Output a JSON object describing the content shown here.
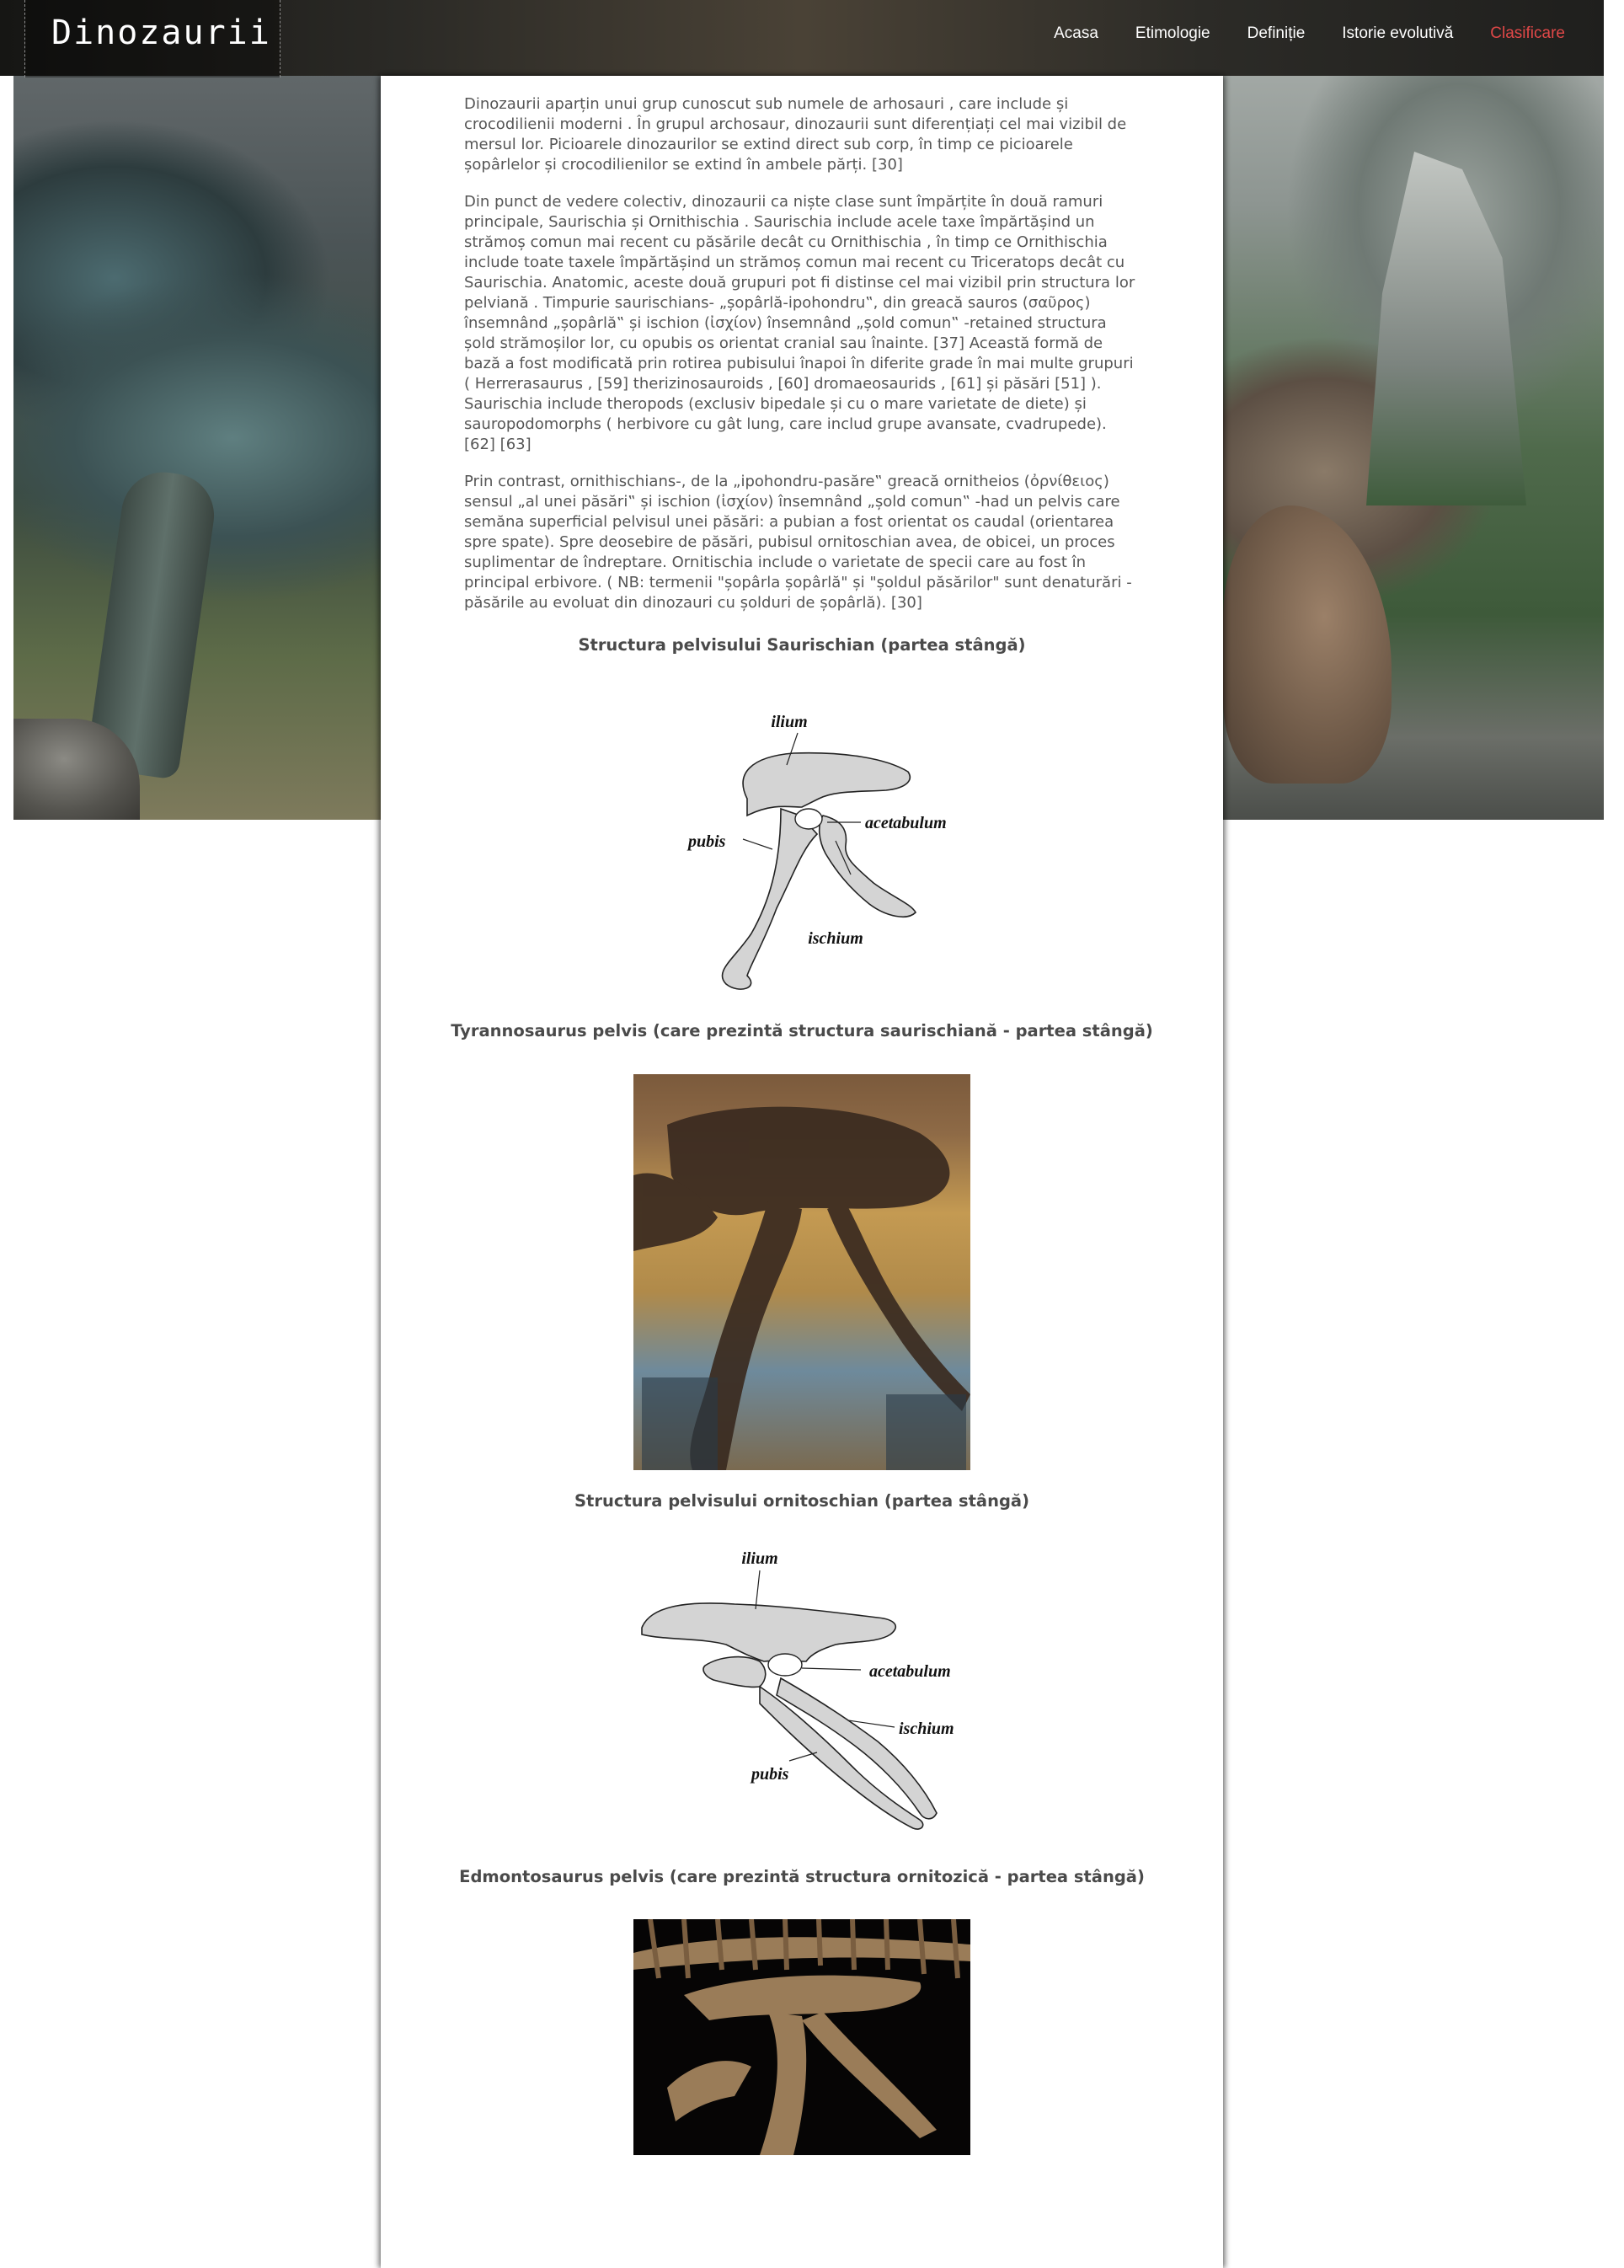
{
  "header": {
    "brand": "Dinozaurii",
    "nav": [
      {
        "label": "Acasa",
        "active": false
      },
      {
        "label": "Etimologie",
        "active": false
      },
      {
        "label": "Definiție",
        "active": false
      },
      {
        "label": "Istorie evolutivă",
        "active": false
      },
      {
        "label": "Clasificare",
        "active": true
      }
    ],
    "active_color": "#e04848"
  },
  "paragraphs": [
    "Dinozaurii aparțin unui grup cunoscut sub numele de arhosauri , care include și crocodilienii moderni . În grupul archosaur, dinozaurii sunt diferențiați cel mai vizibil de mersul lor. Picioarele dinozaurilor se extind direct sub corp, în timp ce picioarele șopârlelor și crocodilienilor se extind în ambele părți. [30]",
    "Din punct de vedere colectiv, dinozaurii ca niște clase sunt împărțite în două ramuri principale, Saurischia și Ornithischia . Saurischia include acele taxe împărtășind un strămoș comun mai recent cu păsările decât cu Ornithischia , în timp ce Ornithischia include toate taxele împărtășind un strămoș comun mai recent cu Triceratops decât cu Saurischia. Anatomic, aceste două grupuri pot fi distinse cel mai vizibil prin structura lor pelviană . Timpurie saurischians- „șopârlă-ipohondru‟, din greacă sauros (σαῦρος) însemnând „șopârlă‟ și ischion (ἰσχίον) însemnând „șold comun‟ -retained structura șold strămoșilor lor, cu opubis os orientat cranial sau înainte. [37] Această formă de bază a fost modificată prin rotirea pubisului înapoi în diferite grade în mai multe grupuri ( Herrerasaurus , [59] therizinosauroids , [60] dromaeosaurids , [61] și păsări [51] ). Saurischia include theropods (exclusiv bipedale și cu o mare varietate de diete) și sauropodomorphs ( herbivore cu gât lung, care includ grupe avansate, cvadrupede). [62] [63]",
    "Prin contrast, ornithischians-, de la „ipohondru-pasăre‟ greacă ornitheios (ὀρνίθειος) sensul „al unei păsări‟ și ischion (ἰσχίον) însemnând „șold comun‟ -had un pelvis care semăna superficial pelvisul unei păsări: a pubian a fost orientat os caudal (orientarea spre spate). Spre deosebire de păsări, pubisul ornitoschian avea, de obicei, un proces suplimentar de îndreptare. Ornitischia include o varietate de specii care au fost în principal erbivore. ( NB: termenii \"șopârla șopârlă\" și \"șoldul păsărilor\" sunt denaturări - păsările au evoluat din dinozauri cu șolduri de șopârlă). [30]"
  ],
  "figures": [
    {
      "caption": "Structura pelvisului Saurischian (partea stângă)",
      "type": "diagram-saurischian",
      "labels": {
        "ilium": "ilium",
        "acetabulum": "acetabulum",
        "pubis": "pubis",
        "ischium": "ischium"
      }
    },
    {
      "caption": "Tyrannosaurus pelvis (care prezintă structura saurischiană - partea stângă)",
      "type": "photo-tyrannosaurus"
    },
    {
      "caption": "Structura pelvisului ornitoschian (partea stângă)",
      "type": "diagram-ornithischian",
      "labels": {
        "ilium": "ilium",
        "acetabulum": "acetabulum",
        "ischium": "ischium",
        "pubis": "pubis"
      }
    },
    {
      "caption": "Edmontosaurus pelvis (care prezintă structura ornitozică - partea stângă)",
      "type": "photo-edmontosaurus"
    }
  ]
}
